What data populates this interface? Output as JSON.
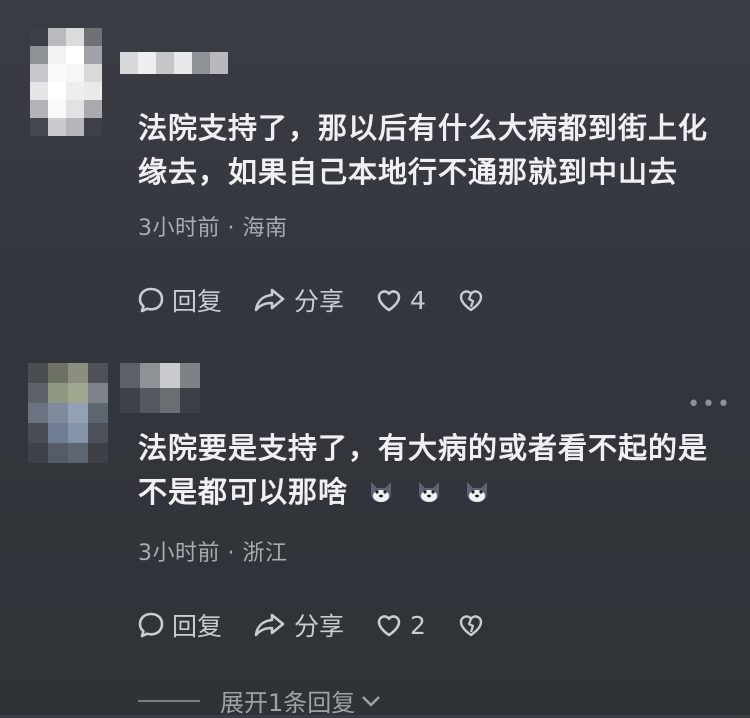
{
  "comments": [
    {
      "text_line1": "法院支持了，那以后有什么大病都到街上化",
      "text_line2": "缘去，如果自己本地行不通那就到中山去",
      "time": "3小时前",
      "location": "海南",
      "reply_label": "回复",
      "share_label": "分享",
      "like_count": "4"
    },
    {
      "text_line1": "法院要是支持了，有大病的或者看不起的是",
      "text_line2": "不是都可以那啥",
      "time": "3小时前",
      "location": "浙江",
      "reply_label": "回复",
      "share_label": "分享",
      "like_count": "2",
      "more_icon": "more-dots-icon"
    }
  ],
  "expand_replies": "展开1条回复",
  "icons": {
    "reply": "comment-bubble-icon",
    "share": "share-arrow-icon",
    "like": "heart-icon",
    "dislike": "broken-heart-icon",
    "emoji": "dog-face-emoji-icon",
    "chevron": "chevron-down-icon"
  },
  "colors": {
    "background": "#33373d",
    "text": "#eef0f2",
    "meta": "#a8abb0",
    "action": "#c9ccd0"
  }
}
